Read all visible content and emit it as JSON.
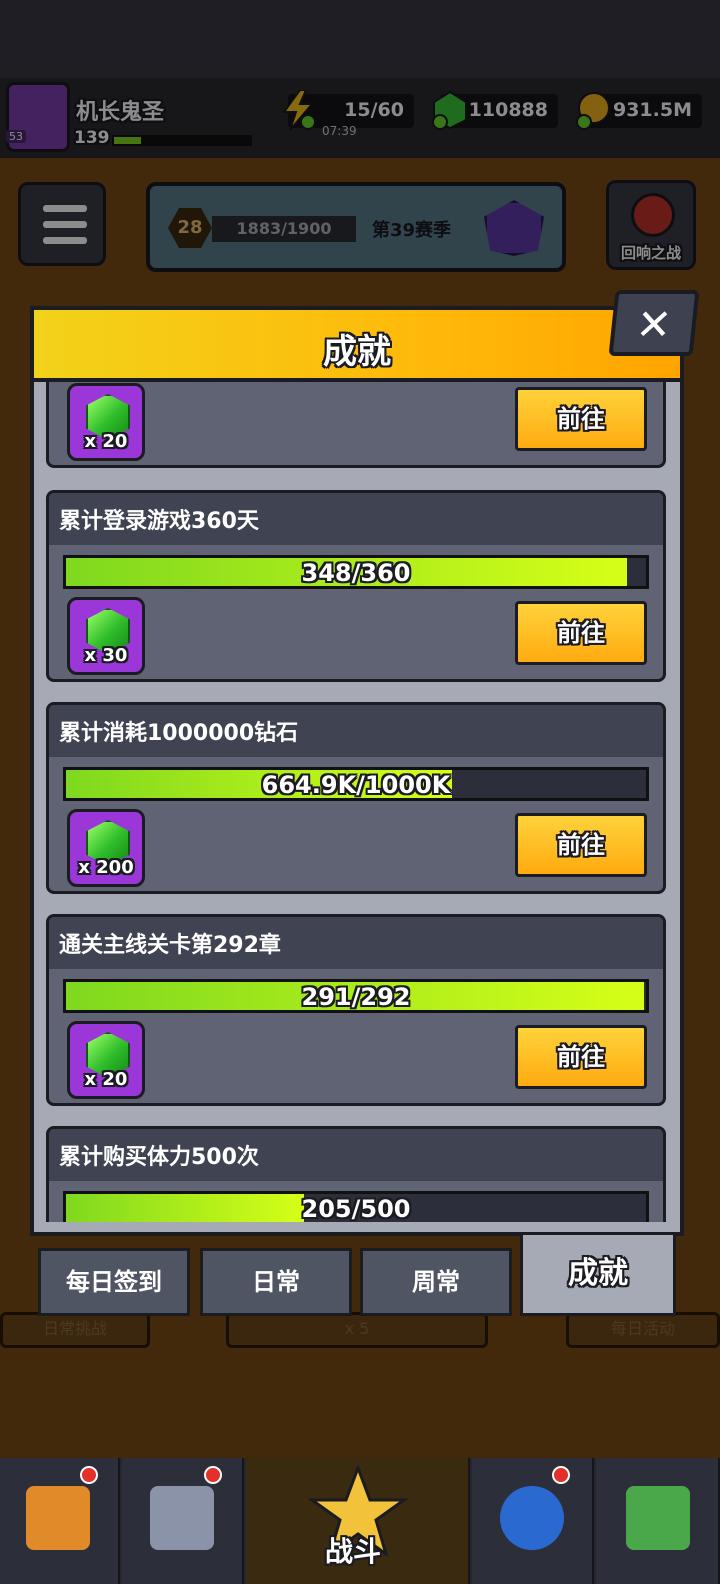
{
  "player": {
    "name": "机长鬼圣",
    "level": "139",
    "avatar_level": "53"
  },
  "resources": {
    "energy": "15/60",
    "energy_timer": "07:39",
    "gems": "110888",
    "coins": "931.5M"
  },
  "season": {
    "level": "28",
    "progress_text": "1883/1900",
    "label": "第39赛季",
    "echo_battle": "回响之战"
  },
  "modal": {
    "title": "成就",
    "close": "✕"
  },
  "achievements": [
    {
      "title": "",
      "progress_text": "",
      "progress": null,
      "reward_count": "x 20",
      "action": "前往"
    },
    {
      "title": "累计登录游戏360天",
      "progress_text": "348/360",
      "progress": 0.967,
      "reward_count": "x 30",
      "action": "前往"
    },
    {
      "title": "累计消耗1000000钻石",
      "progress_text": "664.9K/1000K",
      "progress": 0.665,
      "reward_count": "x 200",
      "action": "前往"
    },
    {
      "title": "通关主线关卡第292章",
      "progress_text": "291/292",
      "progress": 0.997,
      "reward_count": "x 20",
      "action": "前往"
    },
    {
      "title": "累计购买体力500次",
      "progress_text": "205/500",
      "progress": 0.41,
      "reward_count": "",
      "action": ""
    }
  ],
  "tabs": [
    {
      "label": "每日签到",
      "active": false
    },
    {
      "label": "日常",
      "active": false
    },
    {
      "label": "周常",
      "active": false
    },
    {
      "label": "成就",
      "active": true
    }
  ],
  "background": {
    "daily_challenge": "日常挑战",
    "energy_cost": "x 5",
    "daily_event": "每日活动"
  },
  "bottom_nav": {
    "battle_label": "战斗"
  },
  "colors": {
    "accent_yellow": "#ffb90a",
    "progress_green": "#7fd81f",
    "reward_purple": "#9b36d8",
    "go_button": "#ffab10"
  }
}
